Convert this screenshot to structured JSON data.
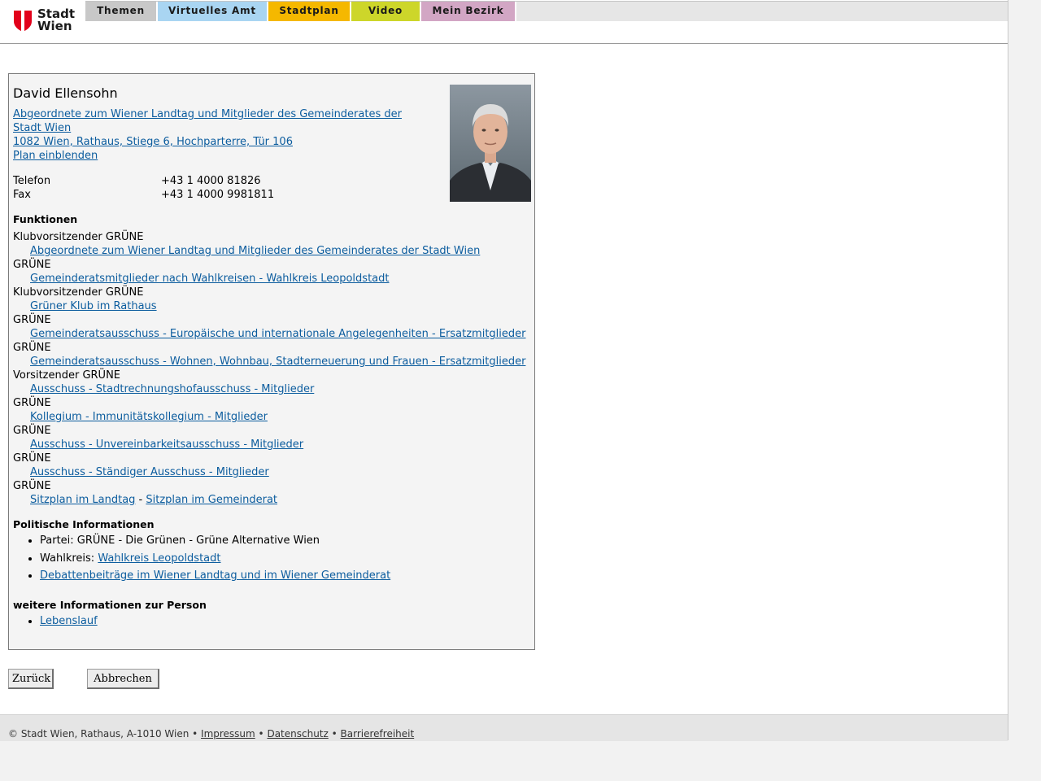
{
  "header": {
    "logo_line1": "Stadt",
    "logo_line2": "Wien",
    "tabs": [
      {
        "label": "Themen",
        "color": "#c8c8c8"
      },
      {
        "label": "Virtuelles Amt",
        "color": "#a9d5f2"
      },
      {
        "label": "Stadtplan",
        "color": "#f5b800"
      },
      {
        "label": "Video",
        "color": "#cdd62a"
      },
      {
        "label": "Mein Bezirk",
        "color": "#d2a6c4"
      }
    ]
  },
  "person": {
    "name": "David Ellensohn",
    "role_link_line1": "Abgeordnete zum Wiener Landtag und Mitglieder des Gemeinderates der",
    "role_link_line2": "Stadt Wien ",
    "address": "1082 Wien, Rathaus, Stiege 6, Hochparterre, Tür 106",
    "map_link": "Plan einblenden",
    "phone_label": "Telefon",
    "phone": "+43 1 4000 81826",
    "fax_label": "Fax",
    "fax": "+43 1 4000 9981811"
  },
  "functions": {
    "title": "Funktionen",
    "items": [
      {
        "role": "Klubvorsitzender GRÜNE",
        "group": "Abgeordnete zum Wiener Landtag und Mitglieder des Gemeinderates der Stadt Wien"
      },
      {
        "role": "GRÜNE",
        "group": "Gemeinderatsmitglieder nach Wahlkreisen - Wahlkreis Leopoldstadt"
      },
      {
        "role": "Klubvorsitzender GRÜNE",
        "group": "Grüner Klub im Rathaus"
      },
      {
        "role": "GRÜNE",
        "group": "Gemeinderatsausschuss - Europäische und internationale Angelegenheiten - Ersatzmitglieder"
      },
      {
        "role": "GRÜNE",
        "group": "Gemeinderatsausschuss - Wohnen, Wohnbau, Stadterneuerung und Frauen - Ersatzmitglieder"
      },
      {
        "role": "Vorsitzender GRÜNE",
        "group": "Ausschuss - Stadtrechnungshofausschuss - Mitglieder"
      },
      {
        "role": "GRÜNE",
        "group": "Kollegium - Immunitätskollegium - Mitglieder"
      },
      {
        "role": "GRÜNE",
        "group": "Ausschuss - Unvereinbarkeitsausschuss - Mitglieder"
      },
      {
        "role": "GRÜNE",
        "group": "Ausschuss - Ständiger Ausschuss - Mitglieder"
      }
    ],
    "last_role": "GRÜNE",
    "seat_landtag": "Sitzplan im Landtag",
    "seat_separator": " - ",
    "seat_gemeinderat": "Sitzplan im Gemeinderat"
  },
  "political": {
    "title": "Politische Informationen",
    "party": "Partei: GRÜNE - Die Grünen - Grüne Alternative Wien",
    "district_label": "Wahlkreis: ",
    "district_link": "Wahlkreis Leopoldstadt",
    "debates_link": "Debattenbeiträge im Wiener Landtag und im Wiener Gemeinderat"
  },
  "further": {
    "title": "weitere Informationen zur Person",
    "cv_link": "Lebenslauf"
  },
  "buttons": {
    "back": "Zurück",
    "cancel": "Abbrechen"
  },
  "footer": {
    "copyright": "© Stadt Wien, Rathaus, A-1010 Wien • ",
    "impressum": "Impressum",
    "sep": " • ",
    "datenschutz": "Datenschutz",
    "barrierefreiheit": "Barrierefreiheit"
  }
}
